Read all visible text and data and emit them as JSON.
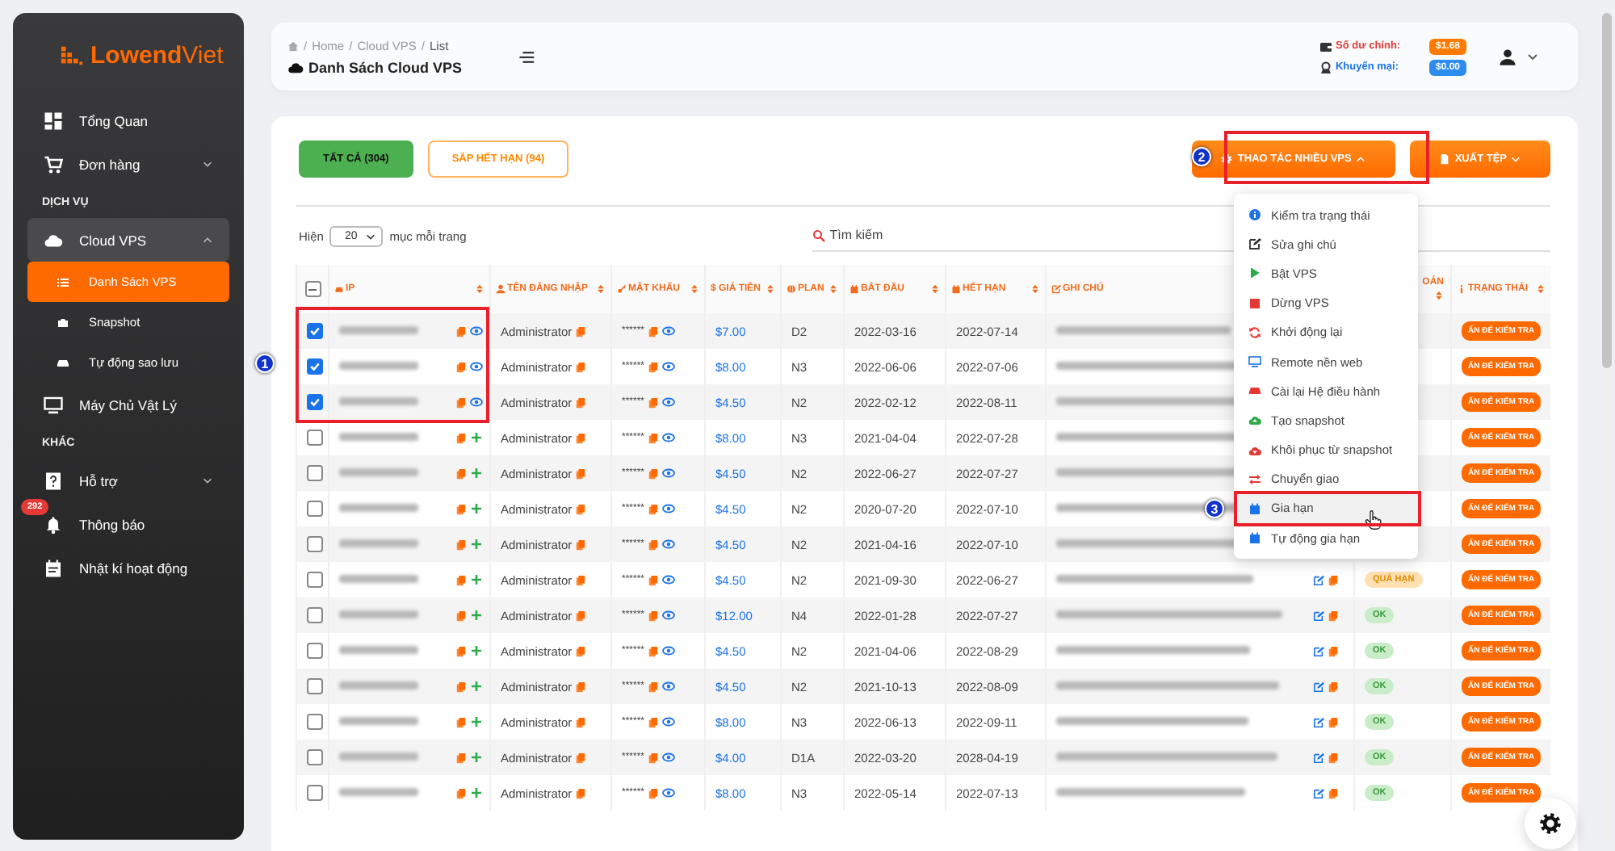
{
  "sidebar": {
    "logo": "**Lowend**Viet",
    "items": [
      {
        "kind": "link",
        "label": "Tổng Quan"
      },
      {
        "kind": "link",
        "label": "Đơn hàng",
        "expanded": false
      },
      {
        "kind": "section",
        "label": "DỊCH VỤ"
      },
      {
        "kind": "link",
        "label": "Cloud VPS",
        "expanded": true,
        "children": [
          {
            "label": "Danh Sách VPS",
            "selected": true
          },
          {
            "label": "Snapshot",
            "selected": false
          },
          {
            "label": "Tự động sao lưu",
            "selected": false
          }
        ]
      },
      {
        "kind": "link",
        "label": "Máy Chủ Vật Lý"
      },
      {
        "kind": "section",
        "label": "KHÁC"
      },
      {
        "kind": "link",
        "label": "Hỗ trợ",
        "expanded": false
      },
      {
        "kind": "link",
        "label": "Thông báo",
        "badge": "292"
      },
      {
        "kind": "link",
        "label": "Nhật kí hoạt động"
      }
    ]
  },
  "header": {
    "breadcrumb": [
      {
        "kind": "separator",
        "text": "/"
      },
      {
        "kind": "link",
        "text": "Home"
      },
      {
        "kind": "separator",
        "text": "/"
      },
      {
        "kind": "link",
        "text": "Cloud VPS"
      },
      {
        "kind": "separator",
        "text": "/"
      },
      {
        "kind": "current",
        "text": "List"
      }
    ],
    "title": "Danh Sách Cloud VPS",
    "balances": [
      {
        "kind": "main",
        "label": "Số dư chính:",
        "value": "$1.68"
      },
      {
        "kind": "promo",
        "label": "Khuyến mại:",
        "value": "$0.00"
      }
    ]
  },
  "filters": [
    {
      "label": "TẤT CẢ (304)",
      "selected": true
    },
    {
      "label": "SẮP HẾT HẠN (94)",
      "selected": false
    }
  ],
  "actions": [
    {
      "label": "THAO TÁC NHIỀU VPS",
      "expanded": true
    },
    {
      "label": "XUẤT TỆP",
      "expanded": false
    }
  ],
  "bulk_menu": [
    {
      "label": "Kiểm tra trạng thái",
      "hovered": false
    },
    {
      "label": "Sửa ghi chú",
      "hovered": false
    },
    {
      "label": "Bật VPS",
      "hovered": false
    },
    {
      "label": "Dừng VPS",
      "hovered": false
    },
    {
      "label": "Khởi động lại",
      "hovered": false
    },
    {
      "label": "Remote nền web",
      "hovered": false
    },
    {
      "label": "Cài lại Hệ điều hành",
      "hovered": false
    },
    {
      "label": "Tạo snapshot",
      "hovered": false
    },
    {
      "label": "Khôi phục từ snapshot",
      "hovered": false
    },
    {
      "label": "Chuyển giao",
      "hovered": false
    },
    {
      "label": "Gia hạn",
      "hovered": true
    },
    {
      "label": "Tự động gia hạn",
      "hovered": false
    }
  ],
  "page_size": {
    "prefix": "Hiện",
    "value": "20",
    "suffix": "mục mỗi trang"
  },
  "search": {
    "placeholder": "Tìm kiếm"
  },
  "table": {
    "select_all_partial": true,
    "columns": [
      {
        "label": "IP"
      },
      {
        "label": "TÊN ĐĂNG NHẬP"
      },
      {
        "label": "MẬT KHẨU"
      },
      {
        "label": "$ GIÁ TIỀN"
      },
      {
        "label": "PLAN"
      },
      {
        "label": "BẮT ĐẦU"
      },
      {
        "label": "HẾT HẠN"
      },
      {
        "label": "GHI CHÚ"
      },
      {
        "label": "OÁN"
      },
      {
        "label": "TRẠNG THÁI"
      }
    ],
    "rows": [
      {
        "checked": true,
        "username": "Administrator",
        "password": "******",
        "price": "$7.00",
        "plan": "D2",
        "start": "2022-03-16",
        "end": "2022-07-14",
        "note_tools": false,
        "status": "ẤN ĐỂ KIỂM TRA"
      },
      {
        "checked": true,
        "username": "Administrator",
        "password": "******",
        "price": "$8.00",
        "plan": "N3",
        "start": "2022-06-06",
        "end": "2022-07-06",
        "note_tools": false,
        "status": "ẤN ĐỂ KIỂM TRA"
      },
      {
        "checked": true,
        "username": "Administrator",
        "password": "******",
        "price": "$4.50",
        "plan": "N2",
        "start": "2022-02-12",
        "end": "2022-08-11",
        "note_tools": false,
        "status": "ẤN ĐỂ KIỂM TRA"
      },
      {
        "checked": false,
        "username": "Administrator",
        "password": "******",
        "price": "$8.00",
        "plan": "N3",
        "start": "2021-04-04",
        "end": "2022-07-28",
        "note_tools": false,
        "status": "ẤN ĐỂ KIỂM TRA"
      },
      {
        "checked": false,
        "username": "Administrator",
        "password": "******",
        "price": "$4.50",
        "plan": "N2",
        "start": "2022-06-27",
        "end": "2022-07-27",
        "note_tools": false,
        "status": "ẤN ĐỂ KIỂM TRA"
      },
      {
        "checked": false,
        "username": "Administrator",
        "password": "******",
        "price": "$4.50",
        "plan": "N2",
        "start": "2020-07-20",
        "end": "2022-07-10",
        "note_tools": false,
        "status": "ẤN ĐỂ KIỂM TRA"
      },
      {
        "checked": false,
        "username": "Administrator",
        "password": "******",
        "price": "$4.50",
        "plan": "N2",
        "start": "2021-04-16",
        "end": "2022-07-10",
        "note_tools": false,
        "status": "ẤN ĐỂ KIỂM TRA"
      },
      {
        "checked": false,
        "username": "Administrator",
        "password": "******",
        "price": "$4.50",
        "plan": "N2",
        "start": "2021-09-30",
        "end": "2022-06-27",
        "note_tools": true,
        "payment": {
          "kind": "overdue",
          "label": "QUÁ HẠN"
        },
        "status": "ẤN ĐỂ KIỂM TRA"
      },
      {
        "checked": false,
        "username": "Administrator",
        "password": "******",
        "price": "$12.00",
        "plan": "N4",
        "start": "2022-01-28",
        "end": "2022-07-27",
        "note_tools": true,
        "payment": {
          "kind": "ok",
          "label": "OK"
        },
        "status": "ẤN ĐỂ KIỂM TRA"
      },
      {
        "checked": false,
        "username": "Administrator",
        "password": "******",
        "price": "$4.50",
        "plan": "N2",
        "start": "2021-04-06",
        "end": "2022-08-29",
        "note_tools": true,
        "payment": {
          "kind": "ok",
          "label": "OK"
        },
        "status": "ẤN ĐỂ KIỂM TRA"
      },
      {
        "checked": false,
        "username": "Administrator",
        "password": "******",
        "price": "$4.50",
        "plan": "N2",
        "start": "2021-10-13",
        "end": "2022-08-09",
        "note_tools": true,
        "payment": {
          "kind": "ok",
          "label": "OK"
        },
        "status": "ẤN ĐỂ KIỂM TRA"
      },
      {
        "checked": false,
        "username": "Administrator",
        "password": "******",
        "price": "$8.00",
        "plan": "N3",
        "start": "2022-06-13",
        "end": "2022-09-11",
        "note_tools": true,
        "payment": {
          "kind": "ok",
          "label": "OK"
        },
        "status": "ẤN ĐỂ KIỂM TRA"
      },
      {
        "checked": false,
        "username": "Administrator",
        "password": "******",
        "price": "$4.00",
        "plan": "D1A",
        "start": "2022-03-20",
        "end": "2028-04-19",
        "note_tools": true,
        "payment": {
          "kind": "ok",
          "label": "OK"
        },
        "status": "ẤN ĐỂ KIỂM TRA"
      },
      {
        "checked": false,
        "username": "Administrator",
        "password": "******",
        "price": "$8.00",
        "plan": "N3",
        "start": "2022-05-14",
        "end": "2022-07-13",
        "note_tools": true,
        "payment": {
          "kind": "ok",
          "label": "OK"
        },
        "status": "ẤN ĐỂ KIỂM TRA"
      }
    ]
  },
  "annotations": [
    {
      "number": "1"
    },
    {
      "number": "2"
    },
    {
      "number": "3"
    }
  ]
}
